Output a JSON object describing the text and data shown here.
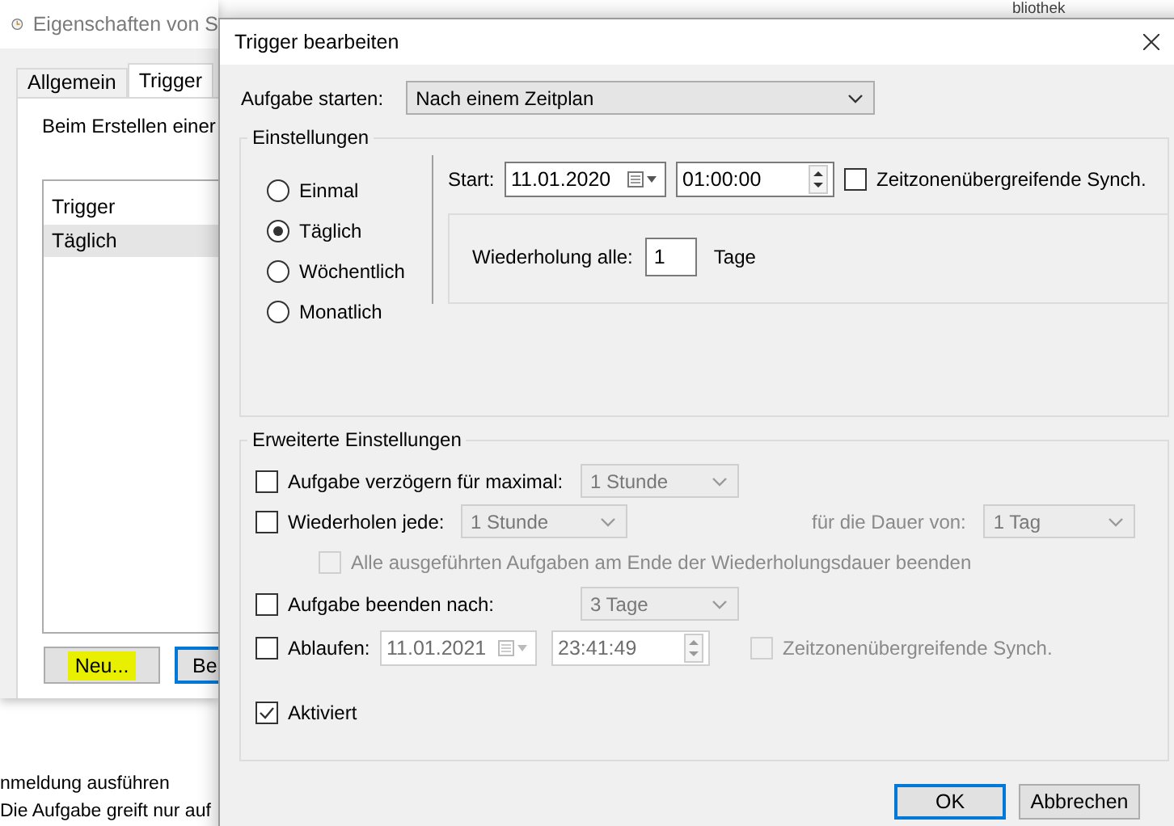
{
  "background_window": {
    "title": "Eigenschaften von S",
    "tabs": [
      {
        "label": "Allgemein",
        "selected": false
      },
      {
        "label": "Trigger",
        "selected": true
      }
    ],
    "description": "Beim Erstellen einer",
    "list": {
      "header": "Trigger",
      "rows": [
        {
          "label": "Täglich",
          "selected": true
        }
      ]
    },
    "buttons": [
      {
        "label": "Neu...",
        "highlighted": true,
        "default": false
      },
      {
        "label": "Be",
        "highlighted": false,
        "default": true
      }
    ]
  },
  "background_texts": [
    "nmeldung ausführen",
    "Die Aufgabe greift nur auf"
  ],
  "top_right_text": "bliothek",
  "dialog": {
    "title": "Trigger bearbeiten",
    "start_task": {
      "label": "Aufgabe starten:",
      "value": "Nach einem Zeitplan",
      "disabled": false
    },
    "settings": {
      "legend": "Einstellungen",
      "schedules": [
        {
          "label": "Einmal",
          "selected": false
        },
        {
          "label": "Täglich",
          "selected": true
        },
        {
          "label": "Wöchentlich",
          "selected": false
        },
        {
          "label": "Monatlich",
          "selected": false
        }
      ],
      "start_label": "Start:",
      "start_date": {
        "value": "11.01.2020",
        "disabled": false
      },
      "start_time": {
        "value": "01:00:00",
        "disabled": false
      },
      "sync": {
        "label": "Zeitzonenübergreifende Synch.",
        "checked": false,
        "disabled": false
      },
      "repeat_label": "Wiederholung alle:",
      "repeat_value": "1",
      "repeat_unit": "Tage"
    },
    "advanced": {
      "legend": "Erweiterte Einstellungen",
      "rows": [
        {
          "kind": "select",
          "checkbox": {
            "label": "Aufgabe verzögern für maximal:",
            "checked": false,
            "disabled": false
          },
          "select": {
            "value": "1 Stunde",
            "disabled": true
          }
        },
        {
          "kind": "repeat",
          "checkbox": {
            "label": "Wiederholen jede:",
            "checked": false,
            "disabled": false
          },
          "select": {
            "value": "1 Stunde",
            "disabled": true
          },
          "duration_label": "für die Dauer von:",
          "duration": {
            "value": "1 Tag",
            "disabled": true
          }
        },
        {
          "kind": "sub",
          "checkbox": {
            "label": "Alle ausgeführten Aufgaben am Ende der Wiederholungsdauer beenden",
            "checked": false,
            "disabled": true
          }
        },
        {
          "kind": "select",
          "checkbox": {
            "label": "Aufgabe beenden nach:",
            "checked": false,
            "disabled": false
          },
          "select": {
            "value": "3 Tage",
            "disabled": true
          }
        },
        {
          "kind": "expire",
          "checkbox": {
            "label": "Ablaufen:",
            "checked": false,
            "disabled": false
          },
          "date": {
            "value": "11.01.2021",
            "disabled": true
          },
          "time": {
            "value": "23:41:49",
            "disabled": true
          },
          "sync": {
            "label": "Zeitzonenübergreifende Synch.",
            "checked": false,
            "disabled": true
          }
        },
        {
          "kind": "enabled",
          "checkbox": {
            "label": "Aktiviert",
            "checked": true,
            "disabled": false
          }
        }
      ]
    },
    "buttons": [
      {
        "label": "OK",
        "default": true
      },
      {
        "label": "Abbrechen",
        "default": false
      }
    ]
  }
}
